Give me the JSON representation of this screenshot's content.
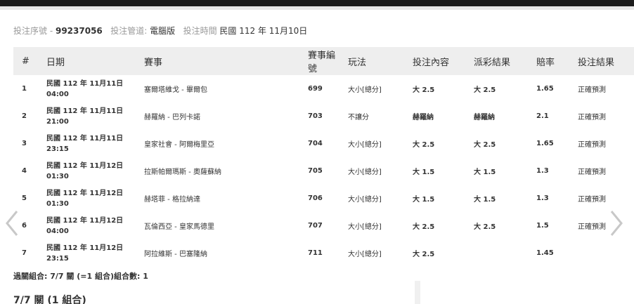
{
  "info": {
    "serial_label": "投注序號 -",
    "serial_value": "99237056",
    "channel_label": "投注管道:",
    "channel_value": "電腦版",
    "time_label": "投注時間",
    "time_value": "民國 112 年 11月10日"
  },
  "columns": [
    "#",
    "日期",
    "賽事",
    "賽事編號",
    "玩法",
    "投注內容",
    "派彩結果",
    "賠率",
    "投注結果"
  ],
  "rows": [
    {
      "num": "1",
      "date1": "民國 112 年 11月11日",
      "date2": "04:00",
      "match": "塞爾塔維戈 - 畢爾包",
      "match_no": "699",
      "play": "大小[總分]",
      "bet": "大 2.5",
      "result": "大 2.5",
      "odds": "1.65",
      "outcome": "正確預測"
    },
    {
      "num": "2",
      "date1": "民國 112 年 11月11日",
      "date2": "21:00",
      "match": "赫羅納 - 巴列卡諾",
      "match_no": "703",
      "play": "不讓分",
      "bet": "赫羅納",
      "result": "赫羅納",
      "odds": "2.1",
      "outcome": "正確預測"
    },
    {
      "num": "3",
      "date1": "民國 112 年 11月11日",
      "date2": "23:15",
      "match": "皇家社會 - 阿爾梅里亞",
      "match_no": "704",
      "play": "大小[總分]",
      "bet": "大 2.5",
      "result": "大 2.5",
      "odds": "1.65",
      "outcome": "正確預測"
    },
    {
      "num": "4",
      "date1": "民國 112 年 11月12日",
      "date2": "01:30",
      "match": "拉斯帕爾瑪斯 - 奧薩蘇納",
      "match_no": "705",
      "play": "大小[總分]",
      "bet": "大 1.5",
      "result": "大 1.5",
      "odds": "1.3",
      "outcome": "正確預測"
    },
    {
      "num": "5",
      "date1": "民國 112 年 11月12日",
      "date2": "01:30",
      "match": "赫塔菲 - 格拉納達",
      "match_no": "706",
      "play": "大小[總分]",
      "bet": "大 1.5",
      "result": "大 1.5",
      "odds": "1.3",
      "outcome": "正確預測"
    },
    {
      "num": "6",
      "date1": "民國 112 年 11月12日",
      "date2": "04:00",
      "match": "瓦倫西亞 - 皇家馬德里",
      "match_no": "707",
      "play": "大小[總分]",
      "bet": "大 2.5",
      "result": "大 2.5",
      "odds": "1.5",
      "outcome": "正確預測"
    },
    {
      "num": "7",
      "date1": "民國 112 年 11月12日",
      "date2": "23:15",
      "match": "阿拉維斯 - 巴塞隆納",
      "match_no": "711",
      "play": "大小[總分]",
      "bet": "大 2.5",
      "result": "",
      "odds": "1.45",
      "outcome": ""
    }
  ],
  "summary": "過關組合: 7/7 關 (=1 組合)組合數: 1",
  "group_title": "7/7 關 (1 組合)",
  "icons": {
    "prev": "chevron-left-icon",
    "next": "chevron-right-icon"
  }
}
